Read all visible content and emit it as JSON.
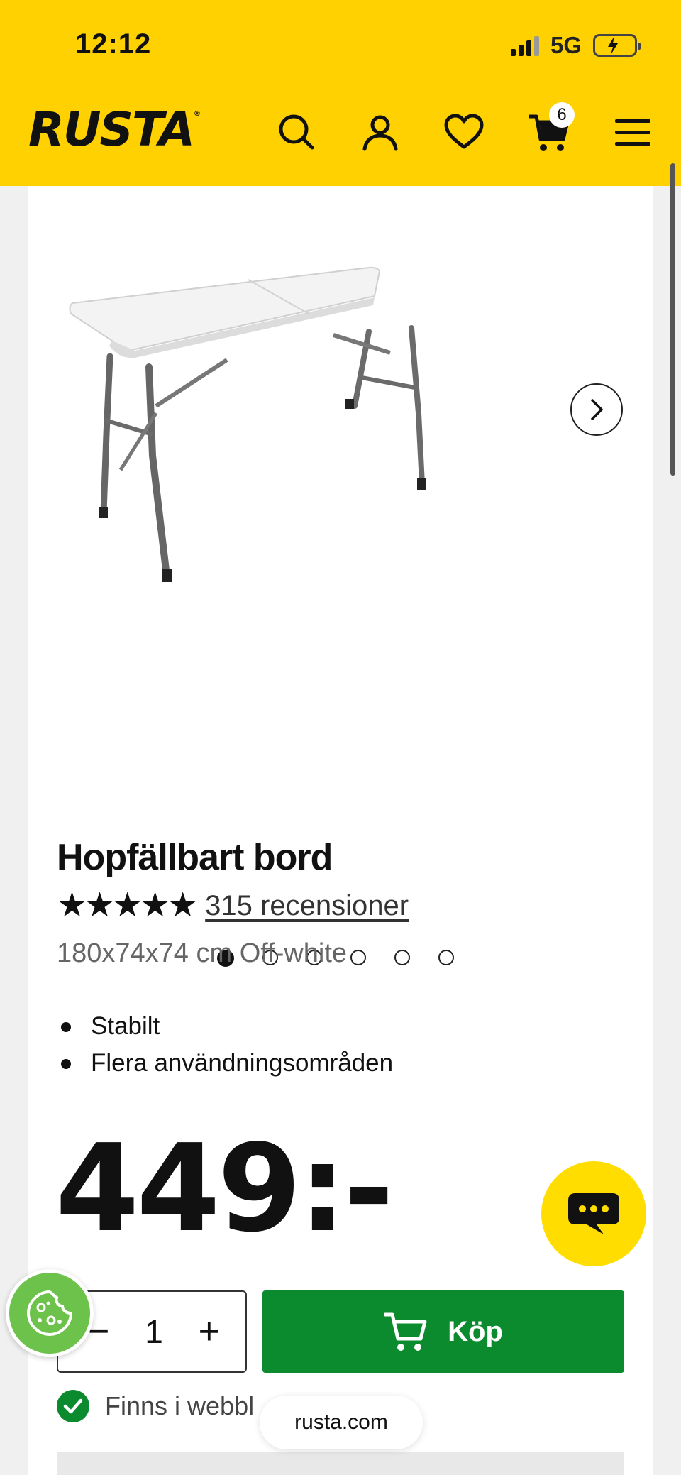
{
  "status_bar": {
    "time": "12:12",
    "network": "5G"
  },
  "header": {
    "logo": "RUSTA",
    "cart_count": "6",
    "brand_color": "#ffd100"
  },
  "icons": {
    "search": "search-icon",
    "account": "user-icon",
    "wishlist": "heart-icon",
    "cart": "cart-icon",
    "menu": "hamburger-menu-icon",
    "next": "chevron-right-icon",
    "chat": "chat-icon",
    "cookie": "cookie-icon"
  },
  "gallery": {
    "slides": 6,
    "active_index": 0
  },
  "product": {
    "title": "Hopfällbart bord",
    "stars": "★★★★★",
    "rating": 5,
    "reviews": "315 recensioner",
    "variant": "180x74x74 cm Off-white",
    "features": [
      "Stabilt",
      "Flera användningsområden"
    ],
    "price": "449:-"
  },
  "purchase": {
    "minus": "−",
    "quantity": "1",
    "plus": "+",
    "buy_label": "Köp",
    "buy_color": "#0b8a2e"
  },
  "stock": {
    "label": "Finns i webbl"
  },
  "browser": {
    "url": "rusta.com"
  }
}
